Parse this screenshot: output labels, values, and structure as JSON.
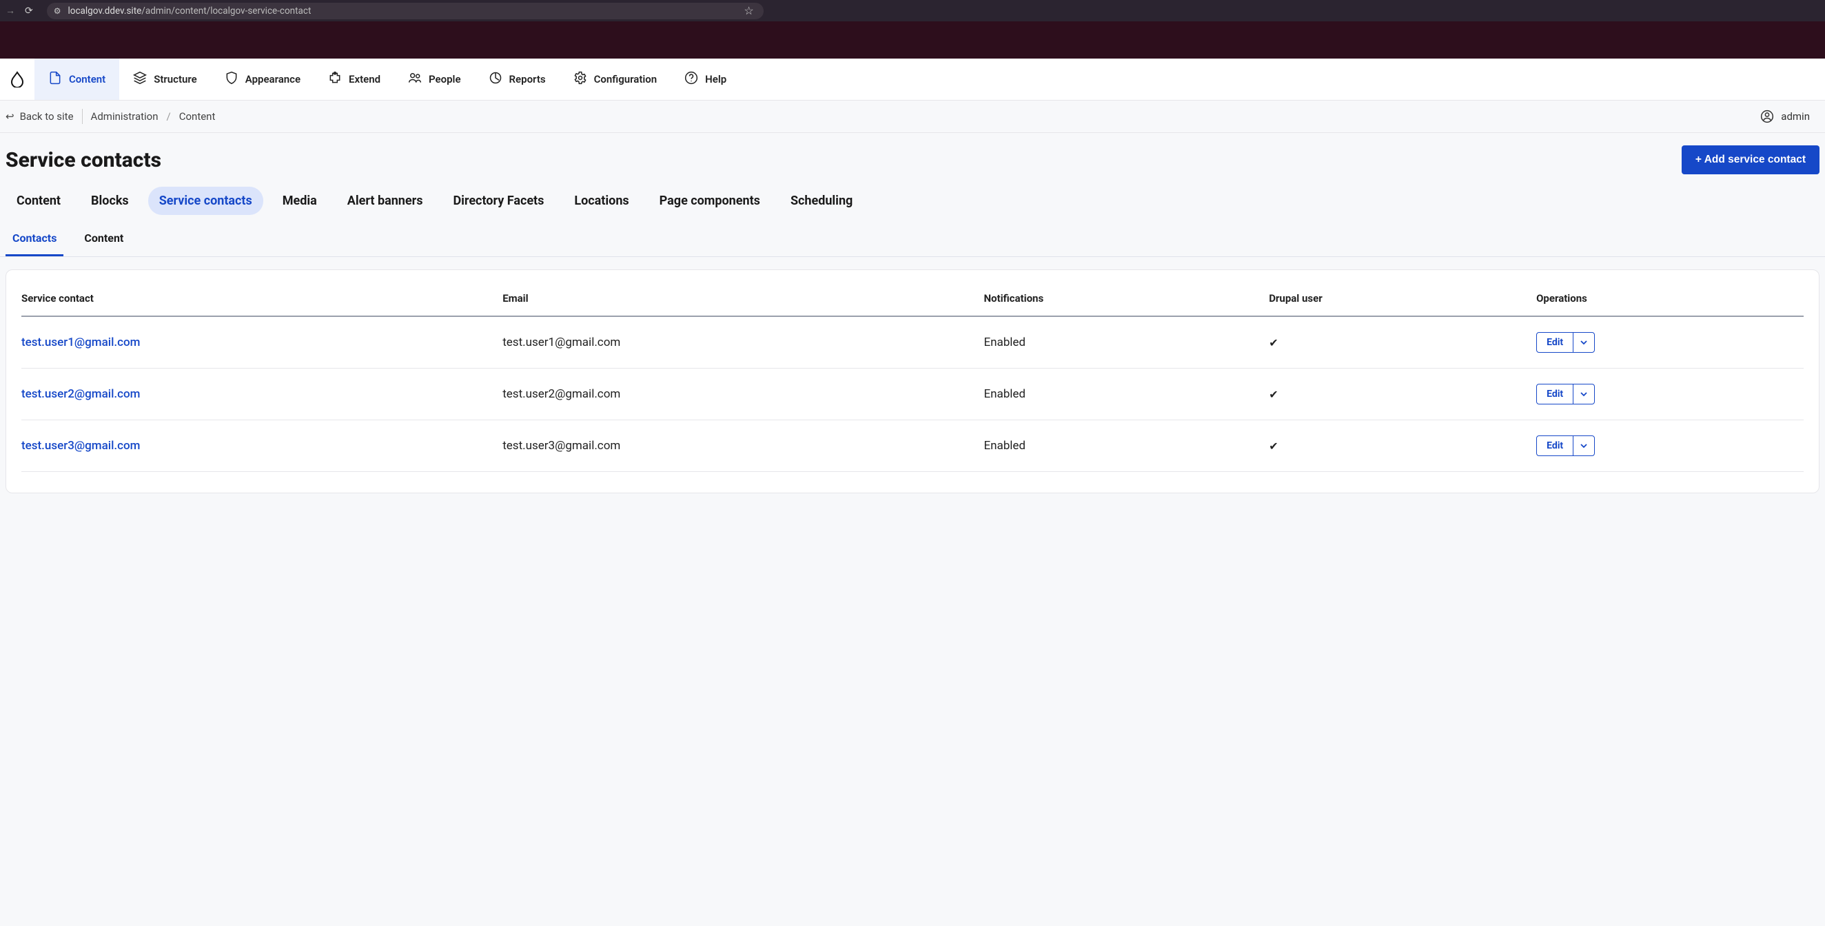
{
  "browser": {
    "url_host": "localgov.ddev.site",
    "url_path": "/admin/content/localgov-service-contact"
  },
  "admin_nav": [
    {
      "label": "Content",
      "icon": "file-icon",
      "active": true
    },
    {
      "label": "Structure",
      "icon": "layers-icon",
      "active": false
    },
    {
      "label": "Appearance",
      "icon": "shield-icon",
      "active": false
    },
    {
      "label": "Extend",
      "icon": "puzzle-icon",
      "active": false
    },
    {
      "label": "People",
      "icon": "users-icon",
      "active": false
    },
    {
      "label": "Reports",
      "icon": "chart-icon",
      "active": false
    },
    {
      "label": "Configuration",
      "icon": "gear-icon",
      "active": false
    },
    {
      "label": "Help",
      "icon": "question-icon",
      "active": false
    }
  ],
  "breadcrumb": {
    "back_label": "Back to site",
    "items": [
      "Administration",
      "Content"
    ]
  },
  "current_user": "admin",
  "page": {
    "title": "Service contacts",
    "add_button": "+ Add service contact"
  },
  "primary_tabs": [
    {
      "label": "Content",
      "active": false
    },
    {
      "label": "Blocks",
      "active": false
    },
    {
      "label": "Service contacts",
      "active": true
    },
    {
      "label": "Media",
      "active": false
    },
    {
      "label": "Alert banners",
      "active": false
    },
    {
      "label": "Directory Facets",
      "active": false
    },
    {
      "label": "Locations",
      "active": false
    },
    {
      "label": "Page components",
      "active": false
    },
    {
      "label": "Scheduling",
      "active": false
    }
  ],
  "secondary_tabs": [
    {
      "label": "Contacts",
      "active": true
    },
    {
      "label": "Content",
      "active": false
    }
  ],
  "table": {
    "columns": [
      "Service contact",
      "Email",
      "Notifications",
      "Drupal user",
      "Operations"
    ],
    "op_label": "Edit",
    "rows": [
      {
        "contact": "test.user1@gmail.com",
        "email": "test.user1@gmail.com",
        "notifications": "Enabled",
        "drupal_user": "✔"
      },
      {
        "contact": "test.user2@gmail.com",
        "email": "test.user2@gmail.com",
        "notifications": "Enabled",
        "drupal_user": "✔"
      },
      {
        "contact": "test.user3@gmail.com",
        "email": "test.user3@gmail.com",
        "notifications": "Enabled",
        "drupal_user": "✔"
      }
    ]
  }
}
